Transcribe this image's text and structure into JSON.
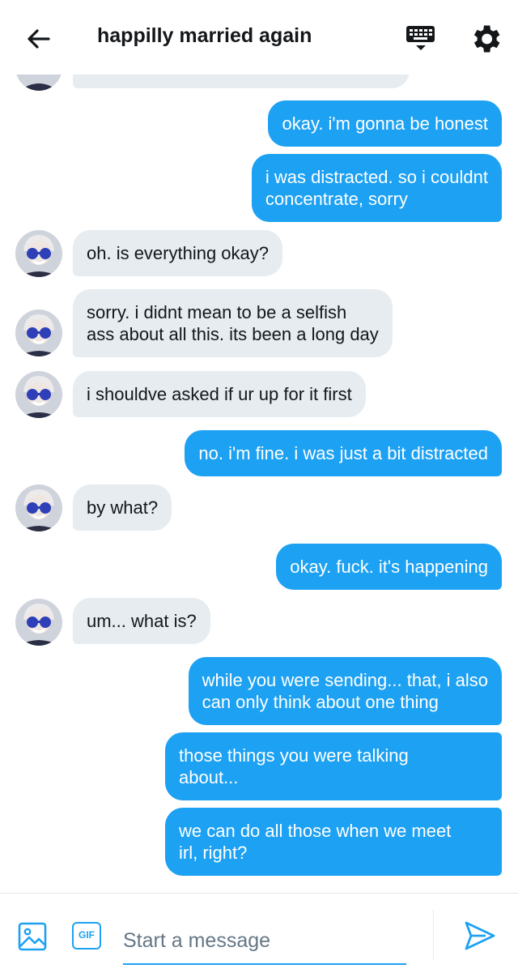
{
  "header": {
    "title": "happilly married again",
    "back_icon": "arrow-left-icon",
    "keyboard_icon": "keyboard-icon",
    "settings_icon": "gear-icon"
  },
  "messages": [
    {
      "dir": "in",
      "text": "",
      "avatar": true
    },
    {
      "dir": "out",
      "text": "okay. i'm gonna be honest"
    },
    {
      "dir": "out",
      "lines": [
        "i was distracted. so i couldnt",
        "concentrate, sorry"
      ]
    },
    {
      "dir": "in",
      "text": "oh. is everything okay?",
      "avatar": true
    },
    {
      "dir": "in",
      "lines": [
        "sorry. i didnt mean to be a selfish",
        "ass about all this. its been a long day"
      ],
      "avatar": true
    },
    {
      "dir": "in",
      "text": "i shouldve asked if ur up for it first",
      "avatar": true
    },
    {
      "dir": "out",
      "text": "no. i'm fine. i was just a bit distracted"
    },
    {
      "dir": "in",
      "text": "by what?",
      "avatar": true
    },
    {
      "dir": "out",
      "text": "okay. fuck. it's happening"
    },
    {
      "dir": "in",
      "text": "um... what is?",
      "avatar": true
    },
    {
      "dir": "out",
      "lines": [
        "while you were sending... that, i also",
        "can only think about one thing"
      ]
    },
    {
      "dir": "out",
      "lines": [
        "those things you were talking",
        "about..."
      ]
    },
    {
      "dir": "out",
      "lines": [
        "we can do all those when we meet",
        "irl, right?"
      ]
    }
  ],
  "composer": {
    "placeholder": "Start a message",
    "image_icon": "image-icon",
    "gif_label": "GIF",
    "send_icon": "send-icon"
  },
  "colors": {
    "accent": "#1da1f2",
    "incoming_bubble": "#e6ecf0",
    "text": "#14171a"
  }
}
